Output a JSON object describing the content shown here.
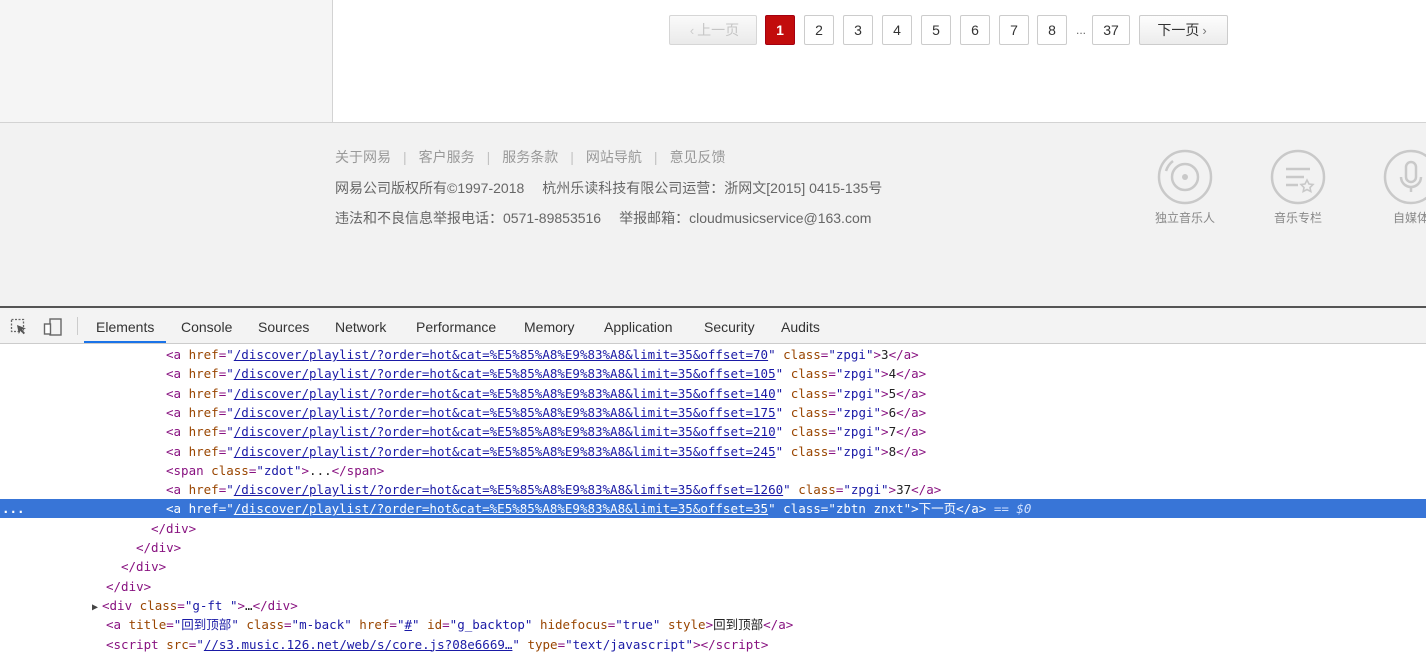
{
  "pagination": {
    "prev_label": "上一页",
    "pages": [
      "1",
      "2",
      "3",
      "4",
      "5",
      "6",
      "7",
      "8"
    ],
    "current_page": "1",
    "ellipsis": "...",
    "last_page": "37",
    "next_label": "下一页"
  },
  "footer": {
    "links": [
      "关于网易",
      "客户服务",
      "服务条款",
      "网站导航",
      "意见反馈"
    ],
    "separator": "|",
    "copyright": "网易公司版权所有©1997-2018",
    "operator": "杭州乐读科技有限公司运营：浙网文[2015] 0415-135号",
    "report_phone": "违法和不良信息举报电话：0571-89853516",
    "report_email": "举报邮箱：cloudmusicservice@163.com",
    "icons": [
      {
        "label": "独立音乐人",
        "icon": "vinyl-icon"
      },
      {
        "label": "音乐专栏",
        "icon": "music-column-icon"
      },
      {
        "label": "自媒体",
        "icon": "microphone-icon"
      }
    ]
  },
  "devtools": {
    "tabs": [
      "Elements",
      "Console",
      "Sources",
      "Network",
      "Performance",
      "Memory",
      "Application",
      "Security",
      "Audits"
    ],
    "active_tab": "Elements",
    "lines": [
      {
        "tag": "a",
        "href": "/discover/playlist/?order=hot&cat=%E5%85%A8%E9%83%A8&limit=35&offset=70",
        "cls": "zpgi",
        "text": "3"
      },
      {
        "tag": "a",
        "href": "/discover/playlist/?order=hot&cat=%E5%85%A8%E9%83%A8&limit=35&offset=105",
        "cls": "zpgi",
        "text": "4"
      },
      {
        "tag": "a",
        "href": "/discover/playlist/?order=hot&cat=%E5%85%A8%E9%83%A8&limit=35&offset=140",
        "cls": "zpgi",
        "text": "5"
      },
      {
        "tag": "a",
        "href": "/discover/playlist/?order=hot&cat=%E5%85%A8%E9%83%A8&limit=35&offset=175",
        "cls": "zpgi",
        "text": "6"
      },
      {
        "tag": "a",
        "href": "/discover/playlist/?order=hot&cat=%E5%85%A8%E9%83%A8&limit=35&offset=210",
        "cls": "zpgi",
        "text": "7"
      },
      {
        "tag": "a",
        "href": "/discover/playlist/?order=hot&cat=%E5%85%A8%E9%83%A8&limit=35&offset=245",
        "cls": "zpgi",
        "text": "8"
      },
      {
        "tag": "span",
        "cls": "zdot",
        "text": "..."
      },
      {
        "tag": "a",
        "href": "/discover/playlist/?order=hot&cat=%E5%85%A8%E9%83%A8&limit=35&offset=1260",
        "cls": "zpgi",
        "text": "37"
      },
      {
        "tag": "a",
        "href": "/discover/playlist/?order=hot&cat=%E5%85%A8%E9%83%A8&limit=35&offset=35",
        "cls": "zbtn znxt",
        "text": "下一页",
        "selected": true,
        "suffix": "== $0"
      },
      {
        "close": "div"
      },
      {
        "close": "div"
      },
      {
        "close": "div"
      },
      {
        "close": "div"
      },
      {
        "collapsed": true,
        "tag": "div",
        "cls": "g-ft ",
        "text": "…"
      },
      {
        "tag": "a",
        "attrs": [
          [
            "title",
            "回到顶部"
          ],
          [
            "class",
            "m-back"
          ],
          [
            "href",
            "#"
          ],
          [
            "id",
            "g_backtop"
          ],
          [
            "hidefocus",
            "true"
          ],
          [
            "style",
            null
          ]
        ],
        "text": "回到顶部"
      },
      {
        "tag": "script",
        "attrs": [
          [
            "src",
            "//s3.music.126.net/web/s/core.js?08e6669…"
          ],
          [
            "type",
            "text/javascript"
          ]
        ],
        "text": ""
      }
    ],
    "selected_marker": "..."
  }
}
